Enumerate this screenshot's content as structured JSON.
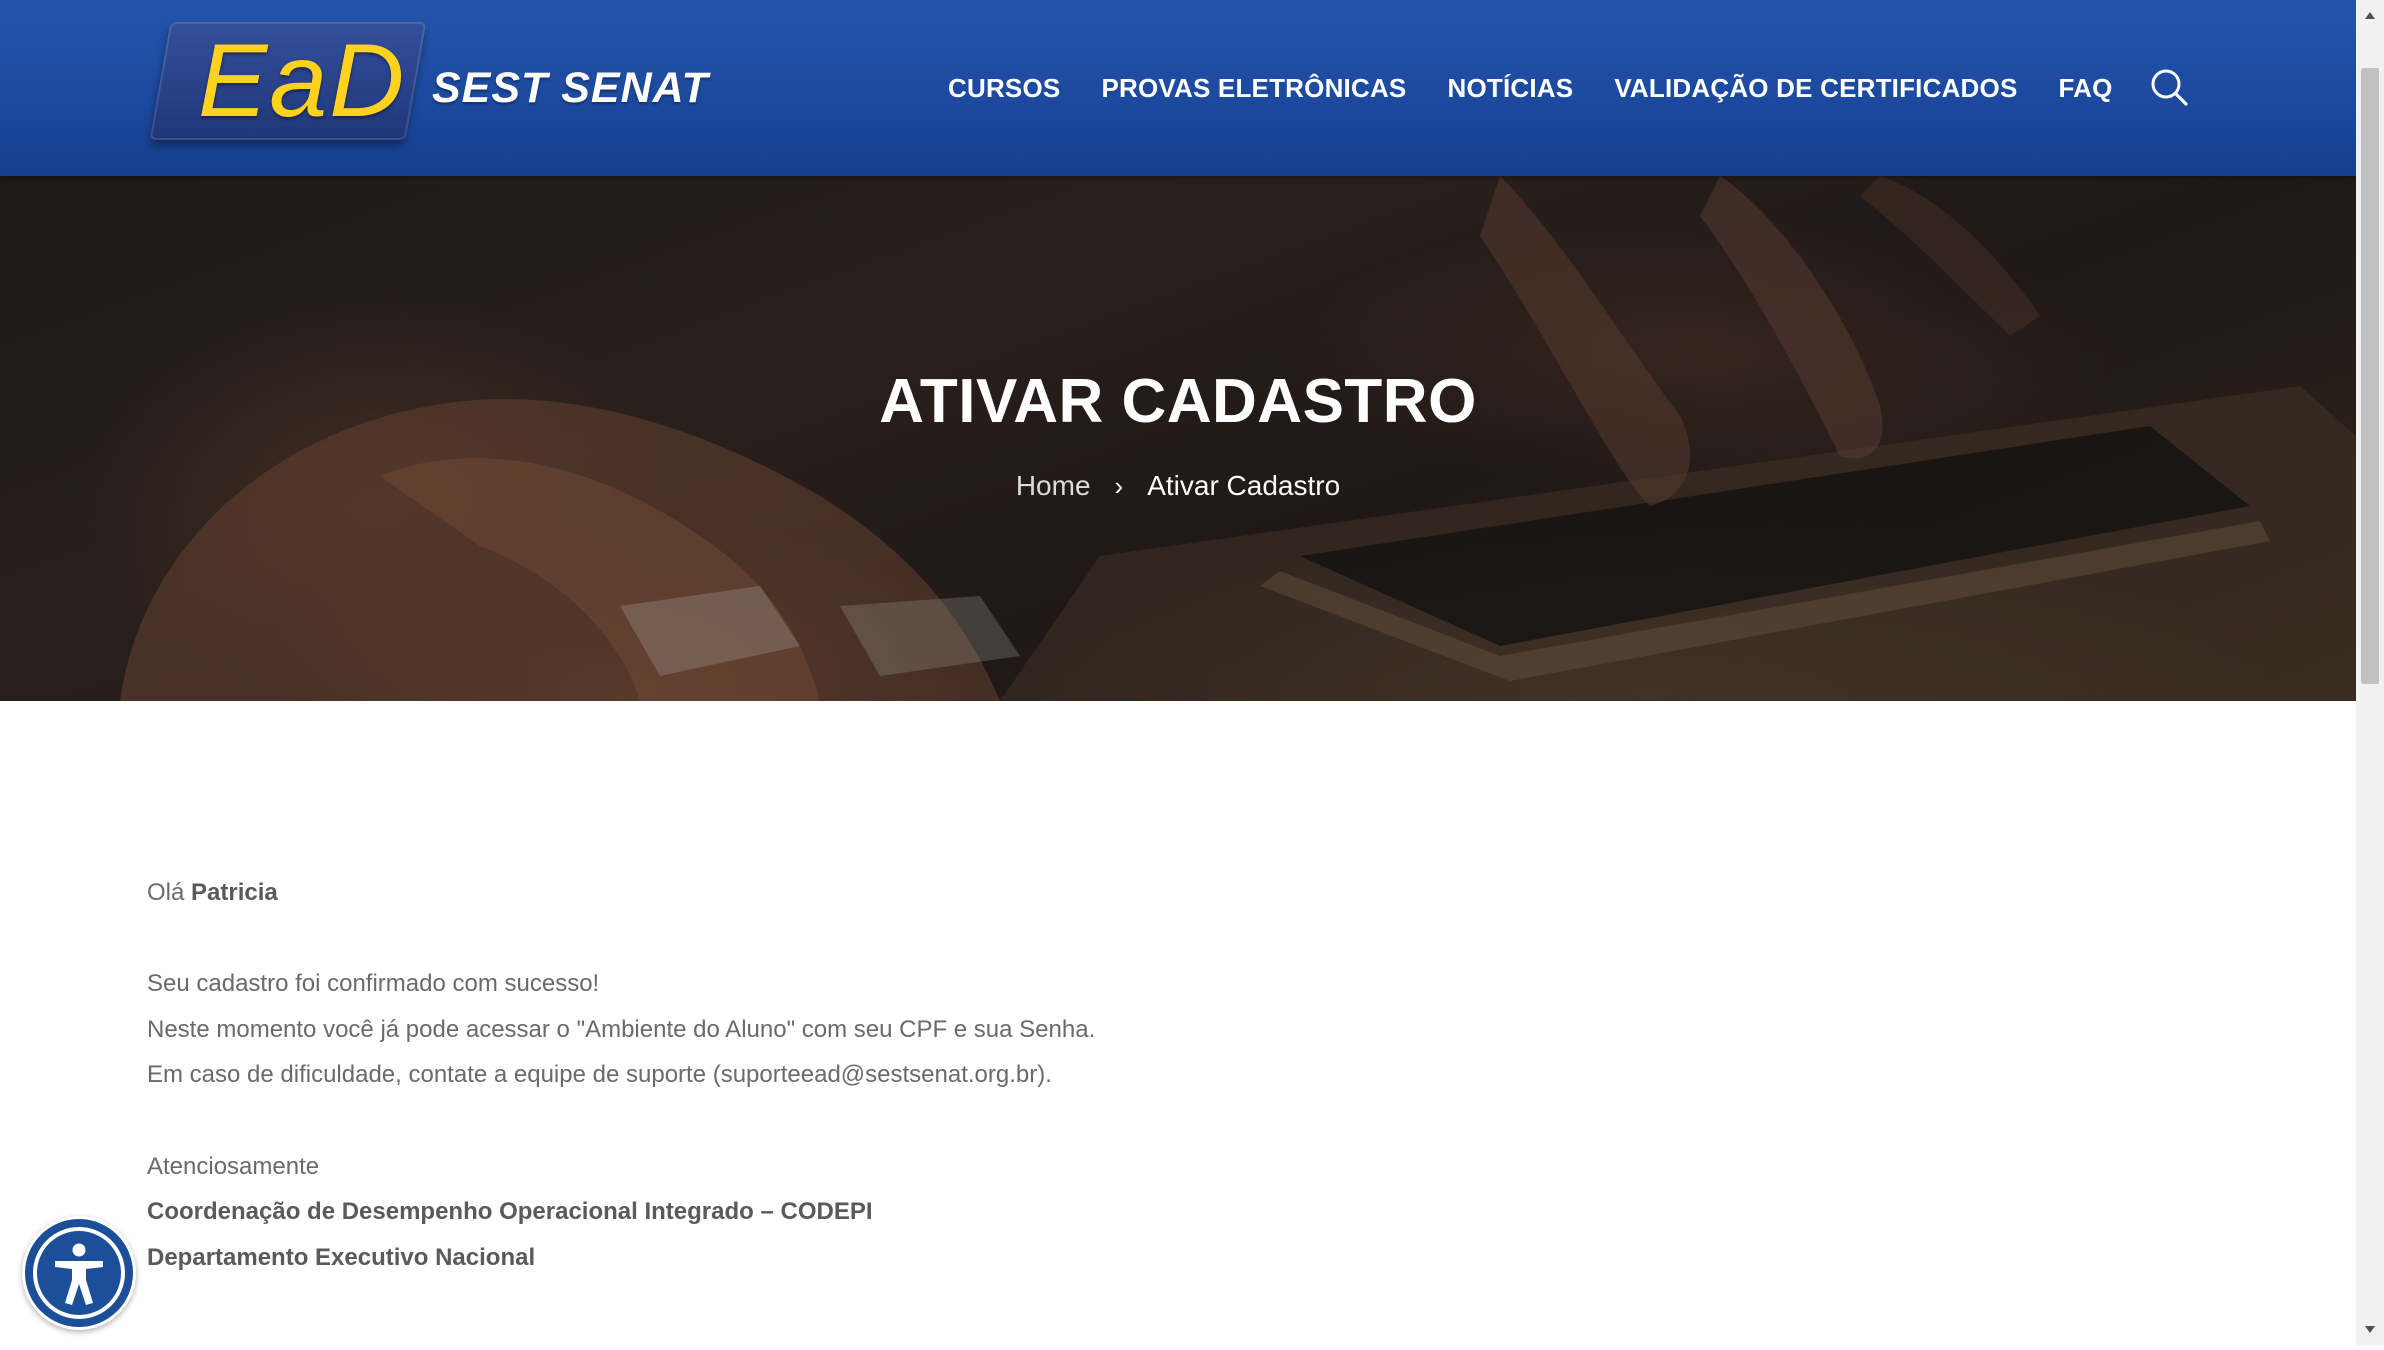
{
  "header": {
    "logo_ead": "EaD",
    "logo_brand": "SEST SENAT",
    "nav": [
      {
        "label": "CURSOS"
      },
      {
        "label": "PROVAS ELETRÔNICAS"
      },
      {
        "label": "NOTÍCIAS"
      },
      {
        "label": "VALIDAÇÃO DE CERTIFICADOS"
      },
      {
        "label": "FAQ"
      }
    ],
    "search_icon": "search-icon"
  },
  "hero": {
    "title": "ATIVAR CADASTRO",
    "breadcrumb": {
      "home": "Home",
      "separator": "›",
      "current": "Ativar Cadastro"
    }
  },
  "content": {
    "greeting_prefix": "Olá",
    "user_name": "Patricia",
    "lines": [
      "Seu cadastro foi confirmado com sucesso!",
      "Neste momento você já pode acessar o \"Ambiente do Aluno\" com seu CPF e sua Senha.",
      "Em caso de dificuldade, contate a equipe de suporte (suporteead@sestsenat.org.br)."
    ],
    "closing": "Atenciosamente",
    "signature_1": "Coordenação de Desempenho Operacional Integrado – CODEPI",
    "signature_2": "Departamento Executivo Nacional"
  },
  "widgets": {
    "accessibility_icon": "accessibility-icon"
  },
  "colors": {
    "header_blue": "#1c4a9f",
    "logo_yellow": "#ffd21f",
    "text_gray": "#6a6a6a",
    "a11y_blue": "#1d4f99"
  }
}
